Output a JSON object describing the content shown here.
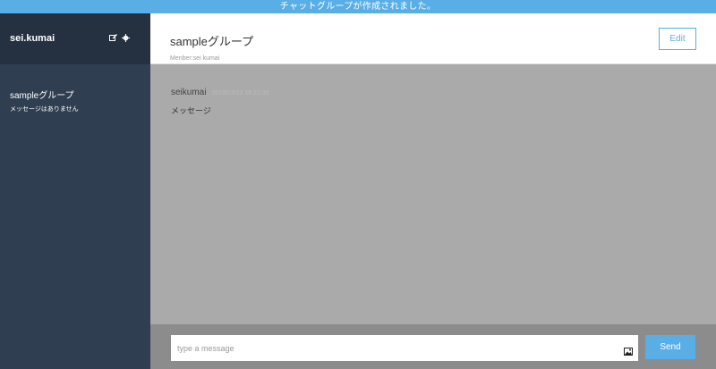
{
  "notice": {
    "text": "チャットグループが作成されました。"
  },
  "sidebar": {
    "user_name": "sei.kumai",
    "icons": [
      "edit-icon",
      "gear-icon"
    ],
    "groups": [
      {
        "name": "sampleグループ",
        "last_message": "メッセージはありません"
      }
    ]
  },
  "main": {
    "group_title": "sampleグループ",
    "members_text": "Menber:sei kumai",
    "edit_label": "Edit"
  },
  "messages": [
    {
      "user": "seikumai",
      "time": "2019/03/22 16:22:30",
      "text": "メッセージ"
    }
  ],
  "form": {
    "placeholder": "type a message",
    "image_icon": "image-icon",
    "send_label": "Send"
  },
  "colors": {
    "accent": "#5aaee6",
    "sidebar": "#2f3e51",
    "sidebar_header": "#253140",
    "chat_background": "#aaaaaa",
    "form_background": "#8c8c8c"
  }
}
